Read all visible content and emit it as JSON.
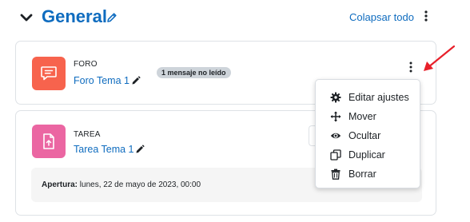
{
  "section": {
    "title": "General",
    "collapse_label": "Colapsar todo"
  },
  "activities": [
    {
      "type": "FORO",
      "name": "Foro Tema 1",
      "badge": "1 mensaje no leído",
      "icon": "forum-icon",
      "color": "#f7634d"
    },
    {
      "type": "TAREA",
      "name": "Tarea Tema 1",
      "icon": "assignment-icon",
      "color": "#eb66a2",
      "availability": {
        "label": "Apertura:",
        "value": "lunes, 22 de mayo de 2023, 00:00"
      }
    }
  ],
  "menu": {
    "items": [
      {
        "label": "Editar ajustes",
        "icon": "gear-icon"
      },
      {
        "label": "Mover",
        "icon": "move-icon"
      },
      {
        "label": "Ocultar",
        "icon": "eye-icon"
      },
      {
        "label": "Duplicar",
        "icon": "duplicate-icon"
      },
      {
        "label": "Borrar",
        "icon": "trash-icon"
      }
    ]
  },
  "colors": {
    "link": "#0f6cbf",
    "annotation_arrow": "#e8202a"
  }
}
